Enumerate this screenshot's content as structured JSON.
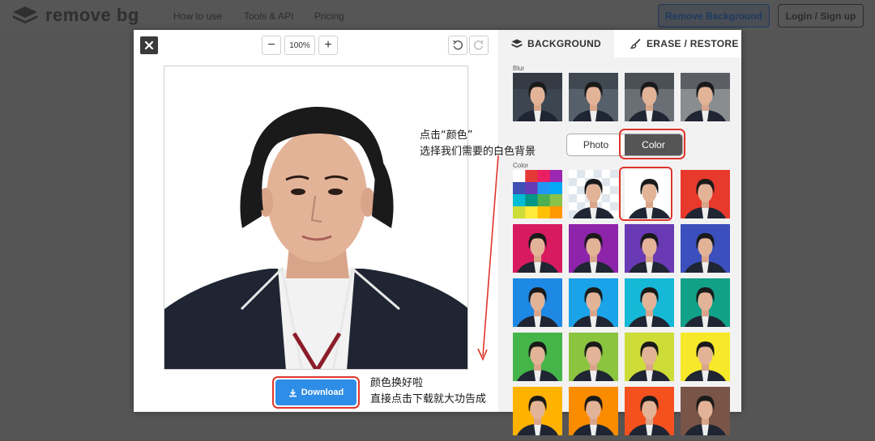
{
  "app": {
    "logo_text": "remove bg"
  },
  "nav": {
    "links": [
      "How to use",
      "Tools & API",
      "Pricing"
    ],
    "primary_button": "Remove Background",
    "secondary_button": "Login / Sign up"
  },
  "toolbar": {
    "zoom_value": "100%",
    "zoom_out": "−",
    "zoom_in": "+"
  },
  "download": {
    "label": "Download"
  },
  "panel": {
    "tabs": [
      {
        "label": "BACKGROUND",
        "icon": "layers-icon",
        "active": true
      },
      {
        "label": "ERASE / RESTORE",
        "icon": "brush-icon",
        "active": false
      }
    ],
    "blur_label": "Blur",
    "toggle": {
      "options": [
        "Photo",
        "Color"
      ],
      "selected": "Color"
    },
    "color_label": "Color",
    "colors": [
      "palette",
      "transparent",
      "#ffffff",
      "#e8392d",
      "#d81b60",
      "#8e24aa",
      "#6a3ab5",
      "#3b4fbd",
      "#1e88e5",
      "#1aa3e8",
      "#16b8d8",
      "#11a088",
      "#45b549",
      "#8bc43f",
      "#cddc39",
      "#f5e92a",
      "#ffb300",
      "#fb8c00",
      "#f4511e",
      "#795548"
    ],
    "selected_color": "#ffffff"
  },
  "annotations": {
    "top_line1": "点击“颜色”",
    "top_line2": "选择我们需要的白色背景",
    "bottom_line1": "颜色换好啦",
    "bottom_line2": "直接点击下载就大功告成"
  },
  "accent_colors": {
    "annotation_red": "#e0352b",
    "download_blue": "#2e8de6"
  }
}
